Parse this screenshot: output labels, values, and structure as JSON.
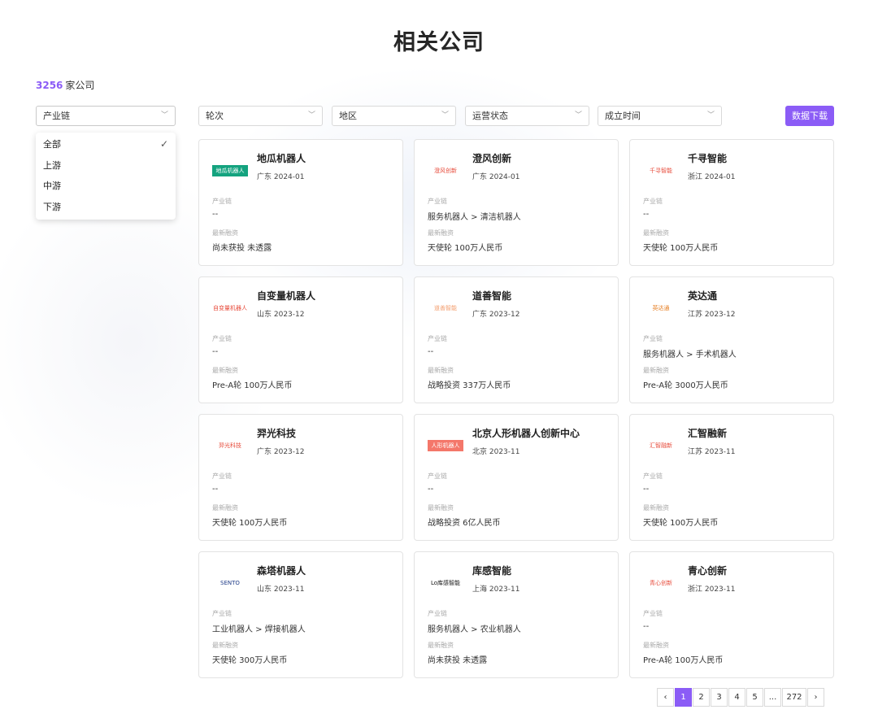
{
  "title": "相关公司",
  "count": {
    "number": "3256",
    "suffix": "家公司"
  },
  "filters": {
    "chain": "产业链",
    "round": "轮次",
    "region": "地区",
    "status": "运营状态",
    "founded": "成立时间"
  },
  "download_label": "数据下载",
  "dropdown": {
    "options": [
      "全部",
      "上游",
      "中游",
      "下游"
    ],
    "selected": "全部"
  },
  "labels": {
    "chain": "产业链",
    "financing": "最新融资"
  },
  "companies": [
    {
      "name": "地瓜机器人",
      "meta": "广东 2024-01",
      "chain": "--",
      "financing": "尚未获投  未透露",
      "logo_text": "地瓜机器人",
      "logo_bg": "#14a37f",
      "logo_fg": "#ffffff"
    },
    {
      "name": "澄风创新",
      "meta": "广东 2024-01",
      "chain": "服务机器人 > 清洁机器人",
      "financing": "天使轮  100万人民币",
      "logo_text": "澄风创新",
      "logo_bg": "#ffffff",
      "logo_fg": "#e74c3c"
    },
    {
      "name": "千寻智能",
      "meta": "浙江 2024-01",
      "chain": "--",
      "financing": "天使轮  100万人民币",
      "logo_text": "千寻智能",
      "logo_bg": "#ffffff",
      "logo_fg": "#e74c3c"
    },
    {
      "name": "自变量机器人",
      "meta": "山东 2023-12",
      "chain": "--",
      "financing": "Pre-A轮  100万人民币",
      "logo_text": "自变量机器人",
      "logo_bg": "#ffffff",
      "logo_fg": "#e74c3c"
    },
    {
      "name": "道善智能",
      "meta": "广东 2023-12",
      "chain": "--",
      "financing": "战略投资  337万人民币",
      "logo_text": "道善智能",
      "logo_bg": "#ffffff",
      "logo_fg": "#f39c6b"
    },
    {
      "name": "英达通",
      "meta": "江苏 2023-12",
      "chain": "服务机器人 > 手术机器人",
      "financing": "Pre-A轮  3000万人民币",
      "logo_text": "英达通",
      "logo_bg": "#ffffff",
      "logo_fg": "#e67e22"
    },
    {
      "name": "羿光科技",
      "meta": "广东 2023-12",
      "chain": "--",
      "financing": "天使轮  100万人民币",
      "logo_text": "羿光科技",
      "logo_bg": "#ffffff",
      "logo_fg": "#e74c3c"
    },
    {
      "name": "北京人形机器人创新中心",
      "meta": "北京 2023-11",
      "chain": "--",
      "financing": "战略投资  6亿人民币",
      "logo_text": "人形机器人",
      "logo_bg": "#f4776a",
      "logo_fg": "#ffffff"
    },
    {
      "name": "汇智融新",
      "meta": "江苏 2023-11",
      "chain": "--",
      "financing": "天使轮  100万人民币",
      "logo_text": "汇智融新",
      "logo_bg": "#ffffff",
      "logo_fg": "#e74c3c"
    },
    {
      "name": "森塔机器人",
      "meta": "山东 2023-11",
      "chain": "工业机器人 > 焊接机器人",
      "financing": "天使轮  300万人民币",
      "logo_text": "SENTO",
      "logo_bg": "#ffffff",
      "logo_fg": "#1f3c88"
    },
    {
      "name": "库感智能",
      "meta": "上海 2023-11",
      "chain": "服务机器人 > 农业机器人",
      "financing": "尚未获投  未透露",
      "logo_text": "Lo库感智能",
      "logo_bg": "#ffffff",
      "logo_fg": "#111111"
    },
    {
      "name": "青心创新",
      "meta": "浙江 2023-11",
      "chain": "--",
      "financing": "Pre-A轮  100万人民币",
      "logo_text": "青心创新",
      "logo_bg": "#ffffff",
      "logo_fg": "#e74c3c"
    }
  ],
  "pagination": {
    "prev": "‹",
    "pages": [
      "1",
      "2",
      "3",
      "4",
      "5",
      "...",
      "272"
    ],
    "current": "1",
    "next": "›"
  },
  "colors": {
    "accent": "#8b5cf6"
  },
  "icons": {
    "chevron": "chevron-down-icon",
    "check": "check-icon"
  }
}
